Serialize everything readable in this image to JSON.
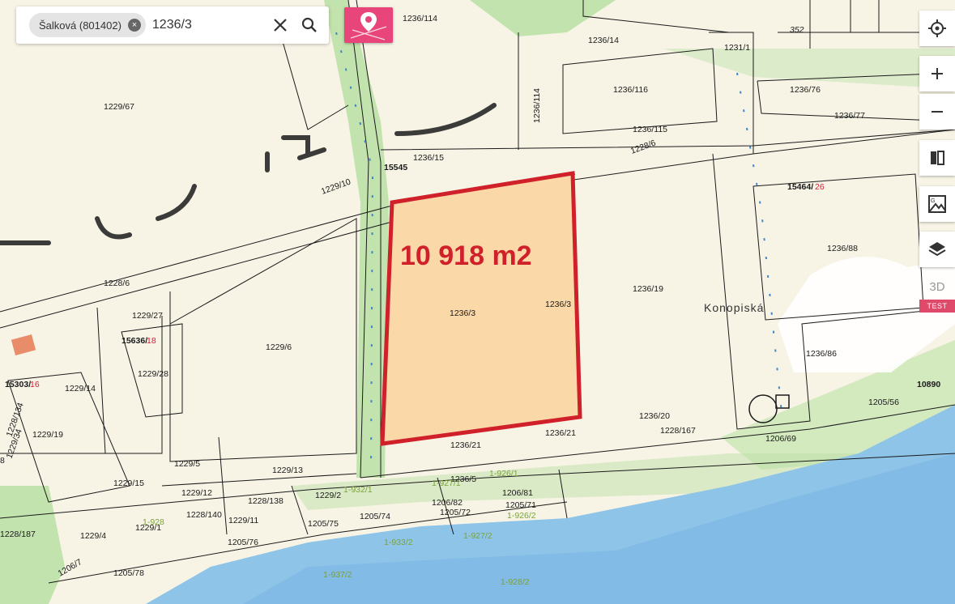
{
  "search": {
    "chip_label": "Šalková (801402)",
    "chip_clear": "×",
    "query": "1236/3"
  },
  "map": {
    "area_label": "10 918 m2",
    "place_name": "Konopiská",
    "highlight_color": "#d0202a",
    "parcel_fill": "#fbd8a8",
    "water_color": "#8ec4e8",
    "green_color": "#b9dfa3",
    "parcels": [
      "1229/67",
      "1236/114",
      "1236/14",
      "1236/116",
      "1236/115",
      "1236/76",
      "1236/77",
      "1231/1",
      "352",
      "1236/15",
      "15545",
      "1228/6",
      "1228/6",
      "1229/10",
      "15464/",
      "26",
      "1236/88",
      "1236/114",
      "1236/3",
      "1236/3",
      "1236/19",
      "1229/27",
      "15636/",
      "18",
      "1229/6",
      "1236/86",
      "15303/",
      "16",
      "1229/14",
      "1229/28",
      "10890",
      "1205/56",
      "1229/19",
      "1236/20",
      "1228/167",
      "1206/69",
      "1236/21",
      "1236/21",
      "1229/5",
      "1229/13",
      "1236/5",
      "1206/82",
      "1206/81",
      "1205/71",
      "1205/72",
      "1205/74",
      "1229/15",
      "1229/12",
      "1228/138",
      "1229/2",
      "1228/140",
      "1229/11",
      "1205/76",
      "1205/75",
      "1229/1",
      "1229/4",
      "1228/187",
      "1206/7",
      "1205/78",
      "1229/34",
      "8",
      "1228/134"
    ],
    "green_labels": [
      "1-926/1",
      "1-927/1",
      "1-926/2",
      "1-927/2",
      "1-928",
      "1-933/2",
      "1-937/2",
      "1-928/2",
      "1-932/1"
    ]
  },
  "toolbar": {
    "label_3d": "3D",
    "test_badge": "TEST",
    "icons": [
      "locate-icon",
      "zoom-in-icon",
      "zoom-out-icon",
      "compare-icon",
      "map-geo-icon",
      "layers-icon"
    ]
  }
}
